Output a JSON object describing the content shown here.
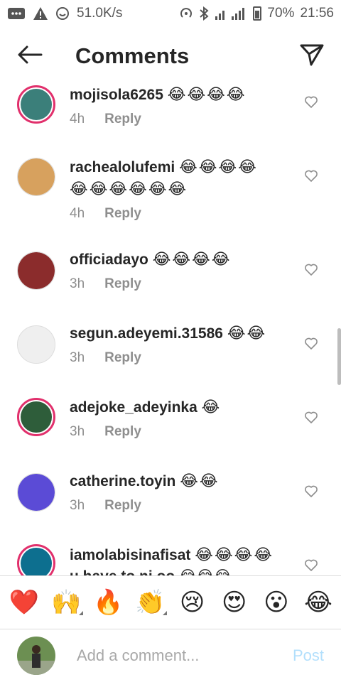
{
  "status_bar": {
    "speed": "51.0K/s",
    "battery": "70%",
    "time": "21:56"
  },
  "header": {
    "title": "Comments"
  },
  "comments": [
    {
      "username": "mojisola6265",
      "emoji": "😂😂😂😂",
      "emoji2": "",
      "time": "4h",
      "reply": "Reply",
      "avatar_color": "#3b7f7a"
    },
    {
      "username": "rachealolufemi",
      "emoji": "😂😂😂😂",
      "emoji2": "😂😂😂😂😂😂",
      "time": "4h",
      "reply": "Reply",
      "avatar_color": "#d7a15e"
    },
    {
      "username": "officiadayo",
      "emoji": "😂😂😂😂",
      "emoji2": "",
      "time": "3h",
      "reply": "Reply",
      "avatar_color": "#8b2c2c"
    },
    {
      "username": "segun.adeyemi.31586",
      "emoji": "😂😂",
      "emoji2": "",
      "time": "3h",
      "reply": "Reply",
      "avatar_color": "#efefef"
    },
    {
      "username": "adejoke_adeyinka",
      "emoji": "😂",
      "emoji2": "",
      "time": "3h",
      "reply": "Reply",
      "avatar_color": "#2e5d3a"
    },
    {
      "username": "catherine.toyin",
      "emoji": "😂😂",
      "emoji2": "",
      "time": "3h",
      "reply": "Reply",
      "avatar_color": "#5b4bd6"
    },
    {
      "username": "iamolabisinafisat",
      "emoji": "😂😂😂😂",
      "emoji2": "u have to ni oo 😂😂😂",
      "time": "",
      "reply": "",
      "avatar_color": "#0d6f8f"
    }
  ],
  "reactions": [
    "❤️",
    "🙌",
    "🔥",
    "👏",
    "😢",
    "😍",
    "😮",
    "😂"
  ],
  "composer": {
    "placeholder": "Add a comment...",
    "post_label": "Post"
  }
}
